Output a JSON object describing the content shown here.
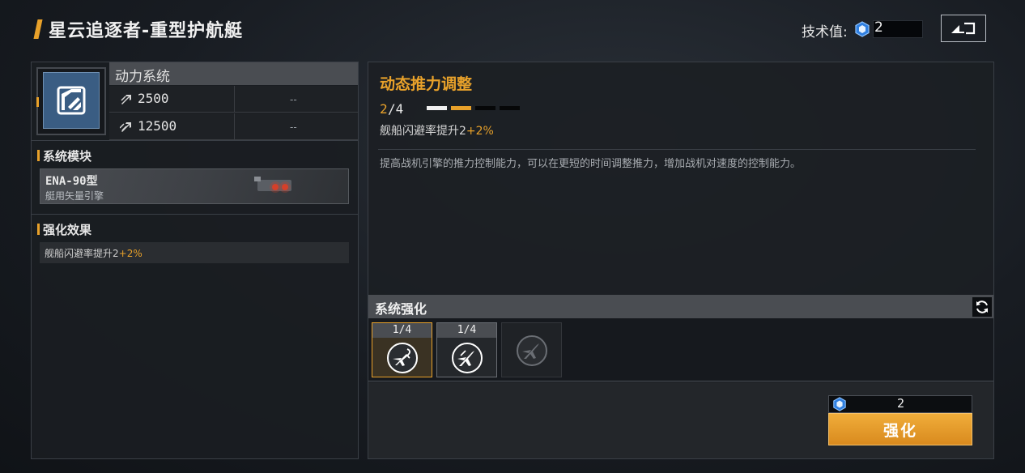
{
  "header": {
    "title": "星云追逐者-重型护航艇",
    "tech_label": "技术值:",
    "tech_value": "2"
  },
  "system": {
    "name": "动力系统",
    "stats": [
      {
        "icon": "thrust-icon",
        "value": "2500",
        "extra": "--"
      },
      {
        "icon": "boost-thrust-icon",
        "value": "12500",
        "extra": "--"
      }
    ]
  },
  "module_section": {
    "title": "系统模块",
    "name": "ENA-90型",
    "subtitle": "艇用矢量引擎"
  },
  "effect_section": {
    "title": "强化效果",
    "text": "舰船闪避率提升2",
    "bonus": "+2%"
  },
  "skill": {
    "title": "动态推力调整",
    "level_current": "2",
    "level_max": "/4",
    "level_progress": 0.5,
    "effect_text": "舰船闪避率提升2",
    "effect_bonus": "+2%",
    "description": "提高战机引擎的推力控制能力，可以在更短的时间调整推力，增加战机对速度的控制能力。"
  },
  "enhance_section": {
    "title": "系统强化",
    "slots": [
      {
        "level": "1/4",
        "icon": "dodge-jet-icon",
        "state": "selected"
      },
      {
        "level": "1/4",
        "icon": "jet-icon",
        "state": "normal"
      },
      {
        "level": "",
        "icon": "jet-locked-icon",
        "state": "locked"
      }
    ]
  },
  "enhance_action": {
    "cost": "2",
    "button_label": "强化"
  },
  "colors": {
    "accent": "#e8a12a",
    "button": "#e39a2a",
    "icon_bg": "#3a5d83"
  }
}
